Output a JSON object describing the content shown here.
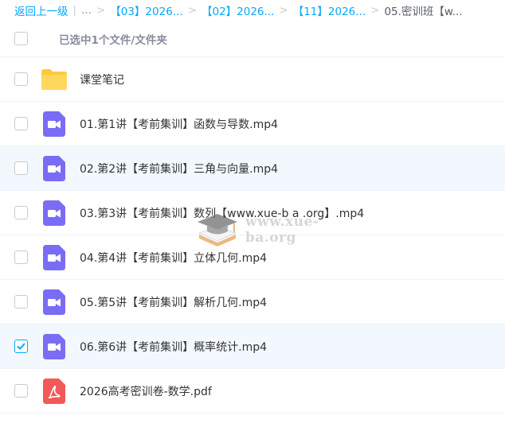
{
  "breadcrumb": {
    "back": "返回上一级",
    "divider": "|",
    "ellipsis": "...",
    "sep": ">",
    "items": [
      "【03】2026...",
      "【02】2026...",
      "【11】2026..."
    ],
    "current": "05.密训班【w..."
  },
  "selection": {
    "text": "已选中1个文件/文件夹",
    "all_checked": false
  },
  "files": [
    {
      "name": "课堂笔记",
      "type": "folder",
      "checked": false,
      "highlight": false
    },
    {
      "name": "01.第1讲【考前集训】函数与导数.mp4",
      "type": "video",
      "checked": false,
      "highlight": false
    },
    {
      "name": "02.第2讲【考前集训】三角与向量.mp4",
      "type": "video",
      "checked": false,
      "highlight": true
    },
    {
      "name": "03.第3讲【考前集训】数列【www.xue-b a .org】.mp4",
      "type": "video",
      "checked": false,
      "highlight": false
    },
    {
      "name": "04.第4讲【考前集训】立体几何.mp4",
      "type": "video",
      "checked": false,
      "highlight": false
    },
    {
      "name": "05.第5讲【考前集训】解析几何.mp4",
      "type": "video",
      "checked": false,
      "highlight": false
    },
    {
      "name": "06.第6讲【考前集训】概率统计.mp4",
      "type": "video",
      "checked": true,
      "highlight": true
    },
    {
      "name": "2026高考密训卷-数学.pdf",
      "type": "pdf",
      "checked": false,
      "highlight": false
    }
  ],
  "watermark": {
    "text": "www.xue-ba.org",
    "icon": "graduation-cap-book-icon"
  },
  "colors": {
    "accent": "#06a7ff",
    "folder": "#ffc93c",
    "video": "#7b6cf6",
    "pdf": "#f15a5a",
    "highlight_row": "#f3f8fe"
  }
}
